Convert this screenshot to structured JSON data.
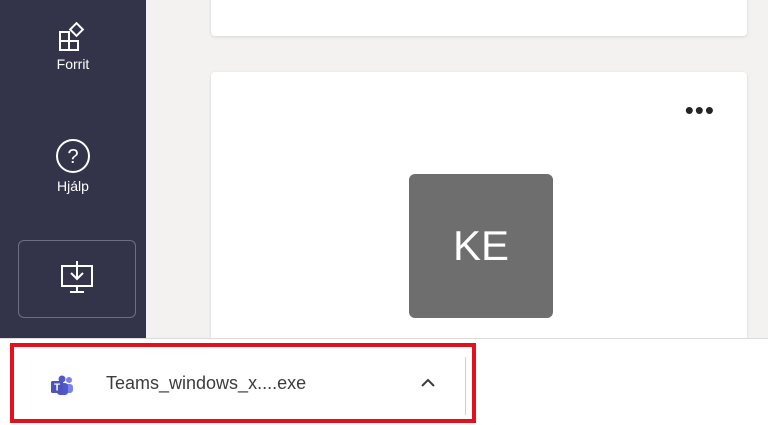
{
  "rail": {
    "items": [
      {
        "label": "Forrit",
        "icon": "apps-icon"
      },
      {
        "label": "Hjálp",
        "icon": "help-icon"
      }
    ],
    "download_icon": "download-app-icon"
  },
  "card": {
    "more_label": "•••",
    "avatar_initials": "KE"
  },
  "download_shelf": {
    "file_name": "Teams_windows_x....exe",
    "file_icon": "teams-icon",
    "expand_icon": "chevron-up-icon",
    "highlight_color": "#e3111e"
  }
}
